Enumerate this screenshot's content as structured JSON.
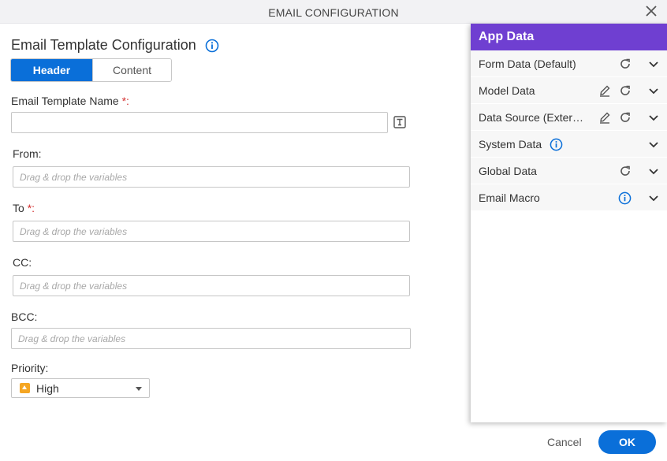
{
  "dialog": {
    "title": "EMAIL CONFIGURATION"
  },
  "form": {
    "section_title": "Email Template Configuration",
    "tabs": [
      {
        "label": "Header",
        "active": true
      },
      {
        "label": "Content",
        "active": false
      }
    ],
    "template_name": {
      "label": "Email Template Name",
      "required_mark": "*:",
      "value": ""
    },
    "from": {
      "label": "From:",
      "placeholder": "Drag & drop the variables"
    },
    "to": {
      "label": "To",
      "required_mark": "*:",
      "placeholder": "Drag & drop the variables"
    },
    "cc": {
      "label": "CC:",
      "placeholder": "Drag & drop the variables"
    },
    "bcc": {
      "label": "BCC:",
      "placeholder": "Drag & drop the variables"
    },
    "priority": {
      "label": "Priority:",
      "value": "High"
    }
  },
  "app_data": {
    "title": "App Data",
    "items": [
      {
        "label": "Form Data (Default)"
      },
      {
        "label": "Model Data"
      },
      {
        "label": "Data Source (Exter…"
      },
      {
        "label": "System Data"
      },
      {
        "label": "Global Data"
      },
      {
        "label": "Email Macro"
      }
    ]
  },
  "footer": {
    "cancel_label": "Cancel",
    "ok_label": "OK"
  },
  "colors": {
    "primary": "#0a6fd9",
    "panel_header": "#6f3fd1",
    "required": "#d32f2f",
    "priority_high": "#f5a623"
  }
}
